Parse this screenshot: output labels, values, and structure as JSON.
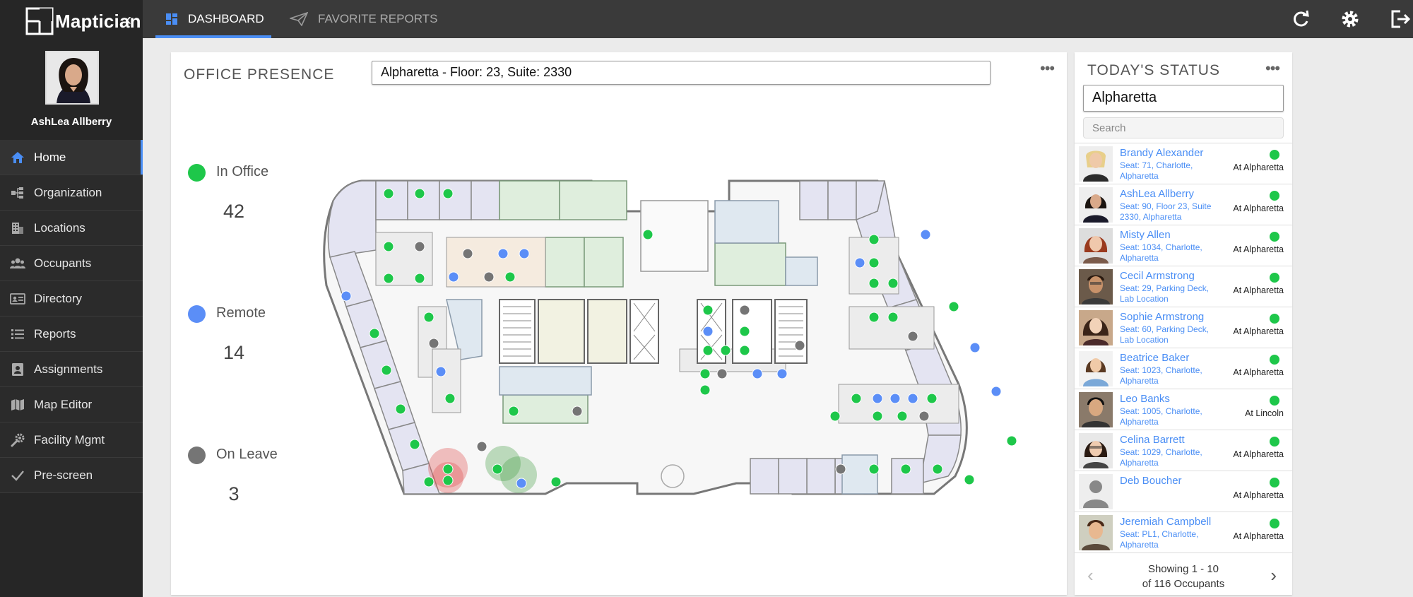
{
  "app": {
    "name": "Maptician"
  },
  "user": {
    "name": "AshLea Allberry"
  },
  "nav": [
    {
      "label": "Home",
      "icon": "home-icon",
      "active": true
    },
    {
      "label": "Organization",
      "icon": "org-chart-icon"
    },
    {
      "label": "Locations",
      "icon": "building-icon"
    },
    {
      "label": "Occupants",
      "icon": "users-icon"
    },
    {
      "label": "Directory",
      "icon": "id-card-icon"
    },
    {
      "label": "Reports",
      "icon": "list-icon"
    },
    {
      "label": "Assignments",
      "icon": "badge-icon"
    },
    {
      "label": "Map Editor",
      "icon": "map-icon"
    },
    {
      "label": "Facility Mgmt",
      "icon": "wrench-gear-icon"
    },
    {
      "label": "Pre-screen",
      "icon": "checkmark-icon"
    }
  ],
  "tabs": {
    "dashboard": "DASHBOARD",
    "favorites": "FAVORITE REPORTS"
  },
  "presence": {
    "title": "OFFICE PRESENCE",
    "location": "Alpharetta - Floor: 23, Suite: 2330",
    "legend": [
      {
        "label": "In Office",
        "count": "42",
        "color": "#1ec74a"
      },
      {
        "label": "Remote",
        "count": "14",
        "color": "#5b8ef7"
      },
      {
        "label": "On Leave",
        "count": "3",
        "color": "#757575"
      }
    ]
  },
  "status": {
    "title": "TODAY'S STATUS",
    "location": "Alpharetta",
    "search_placeholder": "Search",
    "occupants": [
      {
        "name": "Brandy Alexander",
        "seat": "Seat: 71, Charlotte, Alpharetta",
        "location": "At Alpharetta"
      },
      {
        "name": "AshLea Allberry",
        "seat": "Seat: 90, Floor 23, Suite 2330, Alpharetta",
        "location": "At Alpharetta"
      },
      {
        "name": "Misty Allen",
        "seat": "Seat: 1034, Charlotte, Alpharetta",
        "location": "At Alpharetta"
      },
      {
        "name": "Cecil Armstrong",
        "seat": "Seat: 29, Parking Deck, Lab Location",
        "location": "At Alpharetta"
      },
      {
        "name": "Sophie Armstrong",
        "seat": "Seat: 60, Parking Deck, Lab Location",
        "location": "At Alpharetta"
      },
      {
        "name": "Beatrice Baker",
        "seat": "Seat: 1023, Charlotte, Alpharetta",
        "location": "At Alpharetta"
      },
      {
        "name": "Leo Banks",
        "seat": "Seat: 1005, Charlotte, Alpharetta",
        "location": "At Lincoln"
      },
      {
        "name": "Celina Barrett",
        "seat": "Seat: 1029, Charlotte, Alpharetta",
        "location": "At Alpharetta"
      },
      {
        "name": "Deb Boucher",
        "seat": "",
        "location": "At Alpharetta"
      },
      {
        "name": "Jeremiah Campbell",
        "seat": "Seat: PL1, Charlotte, Alpharetta",
        "location": "At Alpharetta"
      }
    ],
    "pager_line1": "Showing 1 - 10",
    "pager_line2": "of 116 Occupants"
  },
  "colors": {
    "accent": "#4a8ef5",
    "in_office": "#1ec74a",
    "remote": "#5b8ef7",
    "on_leave": "#757575"
  }
}
